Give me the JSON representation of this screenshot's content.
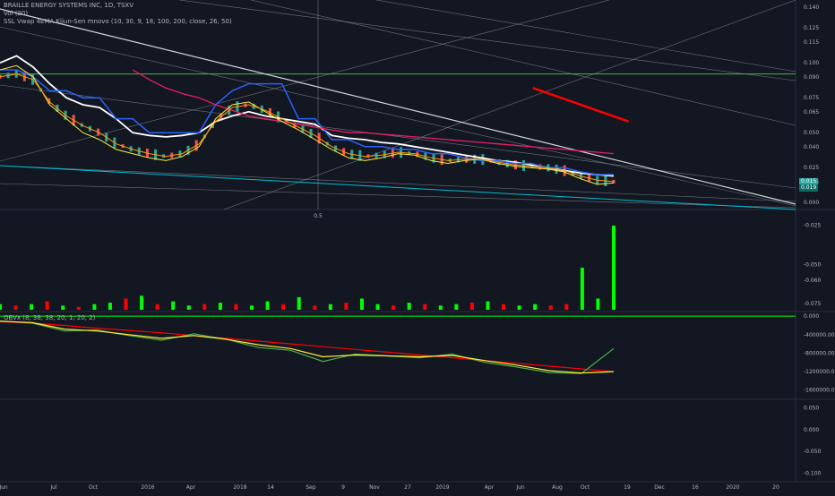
{
  "legend": {
    "symbol": "BRAILLE ENERGY SYSTEMS INC, 1D, TSXV",
    "volume": "Vol (20)",
    "indicator": "SSL Vwap 4EMA Kijun-Sen mnovo (10, 30, 9, 18, 100, 200, close, 26, 50)",
    "obv": "OBVx (8, 38, 38, 20, 1, 20, 2)"
  },
  "fib_label": "0.5",
  "last_price": "0.015",
  "last_price_sub": "0.019",
  "colors": {
    "background": "#131722",
    "up": "#26a69a",
    "down": "#ef5350",
    "vol_up": "#00ff00",
    "vol_down": "#ff0000",
    "white_line": "#ffffff",
    "blue_line": "#2962ff",
    "magenta_line": "#e91e63",
    "yellow_line": "#ffeb3b",
    "orange_line": "#ff9800",
    "green_hline": "#4caf50",
    "cyan_line": "#00bcd4",
    "red_trend": "#ff0000",
    "price_tag": "#26a69a"
  },
  "chart_data": [
    {
      "type": "line",
      "name": "price",
      "ylim": [
        -0.005,
        0.145
      ],
      "yticks": [
        "0.140",
        "0.125",
        "0.115",
        "0.100",
        "0.090",
        "0.075",
        "0.065",
        "0.050",
        "0.040",
        "0.025",
        "0.015",
        "0.000"
      ],
      "ytick_values": [
        0.14,
        0.125,
        0.115,
        0.1,
        0.09,
        0.075,
        0.065,
        0.05,
        0.04,
        0.025,
        0.015,
        0.0
      ],
      "hline": 0.092,
      "series": [
        {
          "key": "ema_white",
          "values": [
            0.1,
            0.105,
            0.097,
            0.085,
            0.075,
            0.07,
            0.068,
            0.06,
            0.05,
            0.048,
            0.047,
            0.048,
            0.05,
            0.058,
            0.062,
            0.065,
            0.062,
            0.06,
            0.058,
            0.056,
            0.048,
            0.046,
            0.045,
            0.043,
            0.042,
            0.04,
            0.038,
            0.036,
            0.034,
            0.032,
            0.03,
            0.029,
            0.027,
            0.025,
            0.023,
            0.021,
            0.02,
            0.019
          ]
        },
        {
          "key": "blue",
          "values": [
            0.095,
            0.095,
            0.09,
            0.08,
            0.08,
            0.075,
            0.075,
            0.06,
            0.06,
            0.05,
            0.05,
            0.05,
            0.05,
            0.07,
            0.08,
            0.085,
            0.085,
            0.085,
            0.06,
            0.06,
            0.045,
            0.045,
            0.04,
            0.04,
            0.038,
            0.038,
            0.035,
            0.035,
            0.032,
            0.03,
            0.03,
            0.028,
            0.028,
            0.025,
            0.025,
            0.022,
            0.02,
            0.02
          ]
        },
        {
          "key": "magenta",
          "values": [
            null,
            null,
            null,
            null,
            null,
            null,
            null,
            null,
            0.095,
            0.088,
            0.082,
            0.078,
            0.075,
            0.07,
            0.066,
            0.062,
            0.06,
            0.058,
            0.056,
            0.054,
            0.052,
            0.05,
            0.05,
            0.049,
            0.048,
            0.047,
            0.046,
            0.045,
            0.044,
            0.043,
            0.042,
            0.041,
            0.04,
            0.039,
            0.038,
            0.037,
            0.036,
            0.035
          ]
        },
        {
          "key": "yellow",
          "values": [
            0.095,
            0.098,
            0.09,
            0.07,
            0.06,
            0.05,
            0.045,
            0.038,
            0.035,
            0.032,
            0.03,
            0.033,
            0.04,
            0.06,
            0.07,
            0.072,
            0.065,
            0.058,
            0.052,
            0.045,
            0.038,
            0.032,
            0.03,
            0.032,
            0.035,
            0.034,
            0.03,
            0.028,
            0.03,
            0.031,
            0.028,
            0.026,
            0.025,
            0.024,
            0.022,
            0.017,
            0.013,
            0.014
          ]
        },
        {
          "key": "orange",
          "values": [
            0.09,
            0.092,
            0.088,
            0.072,
            0.062,
            0.055,
            0.05,
            0.042,
            0.038,
            0.035,
            0.033,
            0.035,
            0.042,
            0.058,
            0.068,
            0.07,
            0.066,
            0.06,
            0.054,
            0.048,
            0.04,
            0.035,
            0.033,
            0.034,
            0.036,
            0.035,
            0.032,
            0.03,
            0.031,
            0.031,
            0.029,
            0.027,
            0.026,
            0.025,
            0.023,
            0.019,
            0.016,
            0.015
          ]
        }
      ],
      "red_trend": {
        "from": [
          0.67,
          0.082
        ],
        "to": [
          0.79,
          0.058
        ]
      }
    },
    {
      "type": "bar",
      "name": "volume",
      "yticks": [
        "-0.025",
        "-0.050",
        "-0.060",
        "-0.075"
      ],
      "ytick_values": [
        -0.025,
        -0.05,
        -0.06,
        -0.075
      ],
      "ylim": [
        -0.08,
        -0.015
      ],
      "values": [
        0.004,
        0.003,
        0.004,
        0.006,
        0.003,
        0.002,
        0.004,
        0.005,
        0.008,
        0.01,
        0.004,
        0.006,
        0.003,
        0.004,
        0.005,
        0.004,
        0.003,
        0.006,
        0.004,
        0.009,
        0.003,
        0.004,
        0.005,
        0.008,
        0.004,
        0.003,
        0.005,
        0.004,
        0.003,
        0.004,
        0.005,
        0.006,
        0.004,
        0.003,
        0.004,
        0.003,
        0.004,
        0.03,
        0.008,
        0.06
      ],
      "up": [
        1,
        0,
        1,
        0,
        1,
        0,
        1,
        1,
        0,
        1,
        0,
        1,
        1,
        0,
        1,
        0,
        1,
        1,
        0,
        1,
        0,
        1,
        0,
        1,
        1,
        0,
        1,
        0,
        1,
        1,
        0,
        1,
        0,
        1,
        1,
        0,
        0,
        1,
        1,
        1
      ]
    },
    {
      "type": "line",
      "name": "obv",
      "yticks": [
        "0.000",
        "-400000.000",
        "-800000.000",
        "-1200000.000",
        "-1600000.000"
      ],
      "ytick_values": [
        0,
        -400000,
        -800000,
        -1200000,
        -1600000
      ],
      "ylim": [
        -1800000,
        100000
      ],
      "series": [
        {
          "key": "red",
          "values": [
            -120000,
            -150000,
            -200000,
            -260000,
            -310000,
            -360000,
            -420000,
            -480000,
            -540000,
            -600000,
            -660000,
            -720000,
            -780000,
            -840000,
            -900000,
            -960000,
            -1020000,
            -1080000,
            -1140000,
            -1200000
          ]
        },
        {
          "key": "green",
          "values": [
            -100000,
            -150000,
            -320000,
            -300000,
            -420000,
            -520000,
            -380000,
            -500000,
            -680000,
            -740000,
            -980000,
            -820000,
            -860000,
            -900000,
            -820000,
            -1000000,
            -1100000,
            -1220000,
            -1240000,
            -700000
          ]
        },
        {
          "key": "yellow",
          "values": [
            -110000,
            -140000,
            -280000,
            -320000,
            -400000,
            -480000,
            -420000,
            -500000,
            -620000,
            -700000,
            -880000,
            -840000,
            -860000,
            -880000,
            -850000,
            -960000,
            -1060000,
            -1180000,
            -1230000,
            -1200000
          ]
        }
      ]
    },
    {
      "type": "line",
      "name": "empty-pane",
      "yticks": [
        "0.050",
        "0.000",
        "-0.050",
        "-0.100"
      ],
      "ytick_values": [
        0.05,
        0,
        -0.05,
        -0.1
      ],
      "ylim": [
        -0.12,
        0.07
      ]
    }
  ],
  "xticks": [
    "Jun",
    "Jul",
    "Oct",
    "2016",
    "Apr",
    "2018",
    "14",
    "Sep",
    "9",
    "Nov",
    "27",
    "2019",
    "Apr",
    "Jun",
    "Aug",
    "Oct",
    "19",
    "Dec",
    "16",
    "2020",
    "20"
  ]
}
